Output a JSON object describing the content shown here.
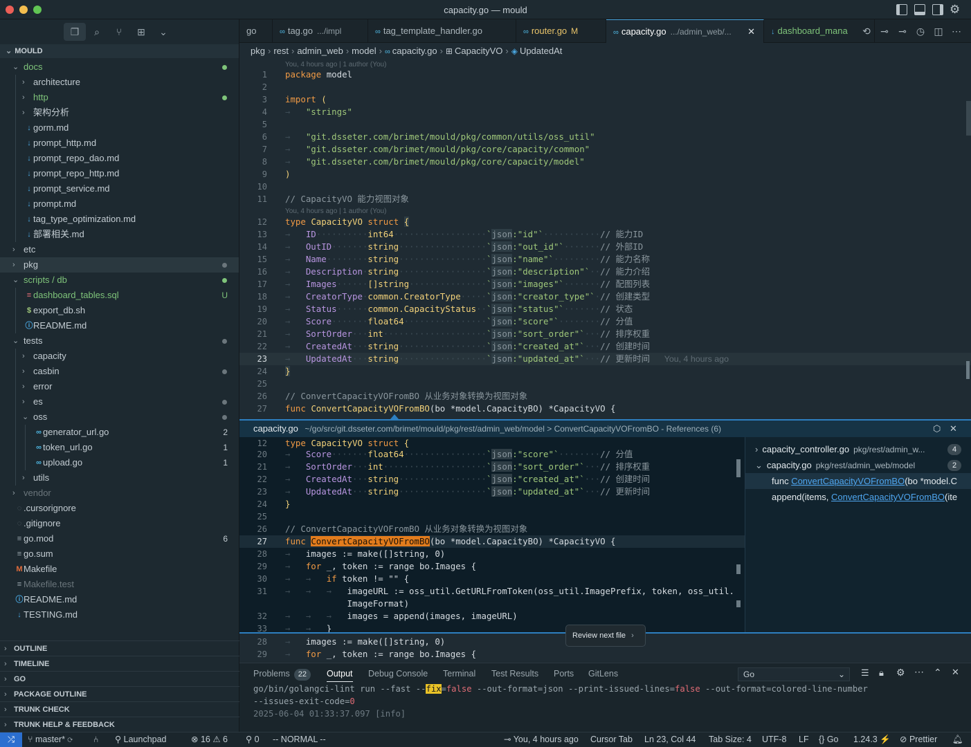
{
  "window": {
    "title": "capacity.go — mould"
  },
  "sidebar": {
    "header": "MOULD",
    "tree": [
      {
        "label": "docs",
        "type": "folder-open",
        "depth": 1,
        "color": "#7fc47a",
        "dot": "#7fc47a"
      },
      {
        "label": "architecture",
        "type": "folder",
        "depth": 2
      },
      {
        "label": "http",
        "type": "folder",
        "depth": 2,
        "color": "#7fc47a",
        "dot": "#7fc47a"
      },
      {
        "label": "架构分析",
        "type": "folder",
        "depth": 2
      },
      {
        "label": "gorm.md",
        "type": "md",
        "depth": 2
      },
      {
        "label": "prompt_http.md",
        "type": "md",
        "depth": 2
      },
      {
        "label": "prompt_repo_dao.md",
        "type": "md",
        "depth": 2
      },
      {
        "label": "prompt_repo_http.md",
        "type": "md",
        "depth": 2
      },
      {
        "label": "prompt_service.md",
        "type": "md",
        "depth": 2
      },
      {
        "label": "prompt.md",
        "type": "md",
        "depth": 2
      },
      {
        "label": "tag_type_optimization.md",
        "type": "md",
        "depth": 2
      },
      {
        "label": "部署相关.md",
        "type": "md",
        "depth": 2
      },
      {
        "label": "etc",
        "type": "folder",
        "depth": 1
      },
      {
        "label": "pkg",
        "type": "folder",
        "depth": 1,
        "dot": "#6b767c",
        "selected": true
      },
      {
        "label": "scripts / db",
        "type": "folder-open",
        "depth": 1,
        "color": "#7fc47a",
        "dot": "#7fc47a"
      },
      {
        "label": "dashboard_tables.sql",
        "type": "sql",
        "depth": 2,
        "color": "#7fc47a",
        "badge": "U",
        "badge_color": "#7fc47a"
      },
      {
        "label": "export_db.sh",
        "type": "sh",
        "depth": 2
      },
      {
        "label": "README.md",
        "type": "info",
        "depth": 2
      },
      {
        "label": "tests",
        "type": "folder-open",
        "depth": 1,
        "dot": "#6b767c"
      },
      {
        "label": "capacity",
        "type": "folder",
        "depth": 2
      },
      {
        "label": "casbin",
        "type": "folder",
        "depth": 2,
        "dot": "#6b767c"
      },
      {
        "label": "error",
        "type": "folder",
        "depth": 2
      },
      {
        "label": "es",
        "type": "folder",
        "depth": 2,
        "dot": "#6b767c"
      },
      {
        "label": "oss",
        "type": "folder-open",
        "depth": 2,
        "dot": "#6b767c"
      },
      {
        "label": "generator_url.go",
        "type": "go",
        "depth": 3,
        "badge": "2",
        "badge_color": "#c3ccd2"
      },
      {
        "label": "token_url.go",
        "type": "go",
        "depth": 3,
        "badge": "1",
        "badge_color": "#c3ccd2"
      },
      {
        "label": "upload.go",
        "type": "go",
        "depth": 3,
        "badge": "1",
        "badge_color": "#c3ccd2"
      },
      {
        "label": "utils",
        "type": "folder",
        "depth": 2
      },
      {
        "label": "vendor",
        "type": "folder",
        "depth": 1,
        "color": "#6b767c"
      },
      {
        "label": ".cursorignore",
        "type": "dim",
        "depth": 1
      },
      {
        "label": ".gitignore",
        "type": "dim",
        "depth": 1
      },
      {
        "label": "go.mod",
        "type": "lines",
        "depth": 1,
        "badge": "6",
        "badge_color": "#c3ccd2"
      },
      {
        "label": "go.sum",
        "type": "lines",
        "depth": 1
      },
      {
        "label": "Makefile",
        "type": "make",
        "depth": 1
      },
      {
        "label": "Makefile.test",
        "type": "lines",
        "depth": 1,
        "color": "#6b767c"
      },
      {
        "label": "README.md",
        "type": "info",
        "depth": 1
      },
      {
        "label": "TESTING.md",
        "type": "md",
        "depth": 1
      }
    ],
    "panels": [
      "OUTLINE",
      "TIMELINE",
      "GO",
      "PACKAGE OUTLINE",
      "TRUNK CHECK",
      "TRUNK HELP & FEEDBACK"
    ]
  },
  "tabs": [
    {
      "label": "go",
      "desc": "",
      "go": false
    },
    {
      "label": "tag.go",
      "desc": ".../impl",
      "go": true
    },
    {
      "label": "tag_template_handler.go",
      "desc": "",
      "go": true
    },
    {
      "label": "router.go",
      "desc": "M",
      "go": true,
      "color": "#e9c46a"
    },
    {
      "label": "capacity.go",
      "desc": ".../admin_web/...",
      "go": true,
      "active": true
    },
    {
      "label": "dashboard_mana",
      "desc": "",
      "go": false,
      "color": "#7fc47a"
    }
  ],
  "breadcrumb": [
    "pkg",
    "rest",
    "admin_web",
    "model",
    "capacity.go",
    "CapacityVO",
    "UpdatedAt"
  ],
  "blame": {
    "top": "You, 4 hours ago | 1 author (You)",
    "struct": "You, 4 hours ago | 1 author (You)",
    "inline": "You, 4 hours ago"
  },
  "editor": {
    "current_line": 23,
    "struct_fields": [
      {
        "ln": 13,
        "name": "ID",
        "type": "int64",
        "tag": "id",
        "comment": "// 能力ID"
      },
      {
        "ln": 14,
        "name": "OutID",
        "type": "string",
        "tag": "out_id",
        "comment": "// 外部ID"
      },
      {
        "ln": 15,
        "name": "Name",
        "type": "string",
        "tag": "name",
        "comment": "// 能力名称"
      },
      {
        "ln": 16,
        "name": "Description",
        "type": "string",
        "tag": "description",
        "comment": "// 能力介绍"
      },
      {
        "ln": 17,
        "name": "Images",
        "type": "[]string",
        "tag": "images",
        "comment": "// 配图列表"
      },
      {
        "ln": 18,
        "name": "CreatorType",
        "type": "common.CreatorType",
        "tag": "creator_type",
        "comment": "// 创建类型"
      },
      {
        "ln": 19,
        "name": "Status",
        "type": "common.CapacityStatus",
        "tag": "status",
        "comment": "// 状态"
      },
      {
        "ln": 20,
        "name": "Score",
        "type": "float64",
        "tag": "score",
        "comment": "// 分值"
      },
      {
        "ln": 21,
        "name": "SortOrder",
        "type": "int",
        "tag": "sort_order",
        "comment": "// 排序权重"
      },
      {
        "ln": 22,
        "name": "CreatedAt",
        "type": "string",
        "tag": "created_at",
        "comment": "// 创建时间"
      },
      {
        "ln": 23,
        "name": "UpdatedAt",
        "type": "string",
        "tag": "updated_at",
        "comment": "// 更新时间"
      }
    ],
    "lines": {
      "l1_kw": "package",
      "l1_name": "model",
      "l3_kw": "import",
      "l4": "\"strings\"",
      "l6": "\"git.dsseter.com/brimet/mould/pkg/common/utils/oss_util\"",
      "l7": "\"git.dsseter.com/brimet/mould/pkg/core/capacity/common\"",
      "l8": "\"git.dsseter.com/brimet/mould/pkg/core/capacity/model\"",
      "l11": "// CapacityVO 能力视图对象",
      "l12_type": "type",
      "l12_name": "CapacityVO",
      "l12_struct": "struct",
      "l26": "// ConvertCapacityVOFromBO 从业务对象转换为视图对象",
      "l27_func": "func",
      "l27_name": "ConvertCapacityVOFromBO",
      "l27_rest": "(bo *model.CapacityBO) *CapacityVO {"
    }
  },
  "peek": {
    "file": "capacity.go",
    "path": "~/go/src/git.dsseter.com/brimet/mould/pkg/rest/admin_web/model > ConvertCapacityVOFromBO - References (6)",
    "groups": [
      {
        "file": "capacity_controller.go",
        "path": "pkg/rest/admin_w...",
        "count": "4"
      },
      {
        "file": "capacity.go",
        "path": "pkg/rest/admin_web/model",
        "count": "2"
      }
    ],
    "refs": [
      {
        "prefix": "func ",
        "match": "ConvertCapacityVOFromBO",
        "suffix": "(bo *model.C"
      },
      {
        "prefix": "append(items, ",
        "match": "ConvertCapacityVOFromBO",
        "suffix": "(ite"
      }
    ],
    "code": {
      "l28": "images := make([]string, 0)",
      "l29": "for _, token := range bo.Images {",
      "l30": "if token != \"\" {",
      "l31a": "imageURL := oss_util.GetURLFromToken(oss_util.ImagePrefix, token, oss_util.",
      "l31b": "ImageFormat)",
      "l32": "images = append(images, imageURL)",
      "l33": "}"
    }
  },
  "review_tip": "Review next file",
  "panel": {
    "tabs": [
      "Problems",
      "Output",
      "Debug Console",
      "Terminal",
      "Test Results",
      "Ports",
      "GitLens"
    ],
    "problems_count": "22",
    "active": "Output",
    "output_channel": "Go",
    "output_lines": [
      "go/bin/golangci-lint run --fast --fix=false --out-format=json --print-issued-lines=false --out-format=colored-line-number",
      "--issues-exit-code=0",
      "2025-06-04 01:33:37.097 [info]"
    ]
  },
  "statusbar": {
    "branch": "master*",
    "launchpad": "Launchpad",
    "errors": "16",
    "warnings": "6",
    "ports": "0",
    "mode": "-- NORMAL --",
    "blame": "You, 4 hours ago",
    "cursor_tab": "Cursor Tab",
    "position": "Ln 23, Col 44",
    "tab_size": "Tab Size: 4",
    "encoding": "UTF-8",
    "eol": "LF",
    "language": "Go",
    "go_version": "1.24.3",
    "formatter": "Prettier"
  },
  "colors": {
    "accent": "#2d7fc0",
    "git_added": "#7fc47a",
    "modified": "#e9c46a"
  }
}
